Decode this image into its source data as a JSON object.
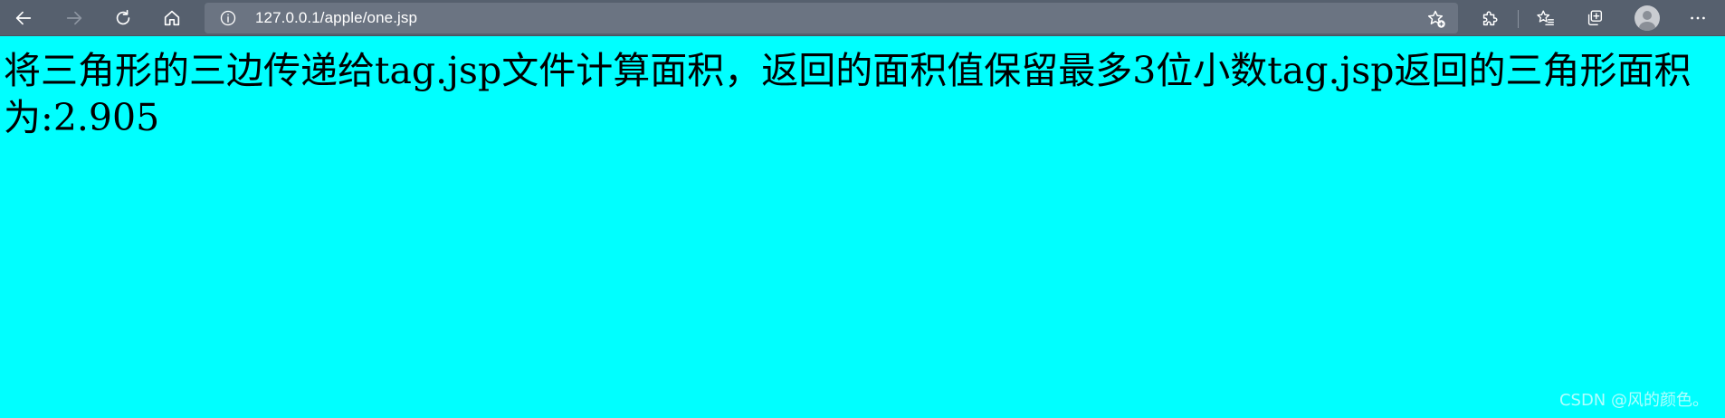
{
  "browser": {
    "url": "127.0.0.1/apple/one.jsp",
    "icons": {
      "back": "back-arrow-icon",
      "forward": "forward-arrow-icon",
      "refresh": "refresh-icon",
      "home": "home-icon",
      "site_info": "info-icon",
      "add_favorite": "star-plus-icon",
      "extensions": "puzzle-icon",
      "favorites": "favorites-icon",
      "collections": "collections-icon",
      "profile": "avatar",
      "more": "more-icon"
    },
    "colors": {
      "toolbar": "#56606e",
      "addressbar": "#6b7482"
    }
  },
  "page": {
    "background": "#00ffff",
    "text": "将三角形的三边传递给tag.jsp文件计算面积，返回的面积值保留最多3位小数tag.jsp返回的三角形面积为:2.905"
  },
  "watermark": {
    "text": "CSDN @风的颜色。"
  }
}
